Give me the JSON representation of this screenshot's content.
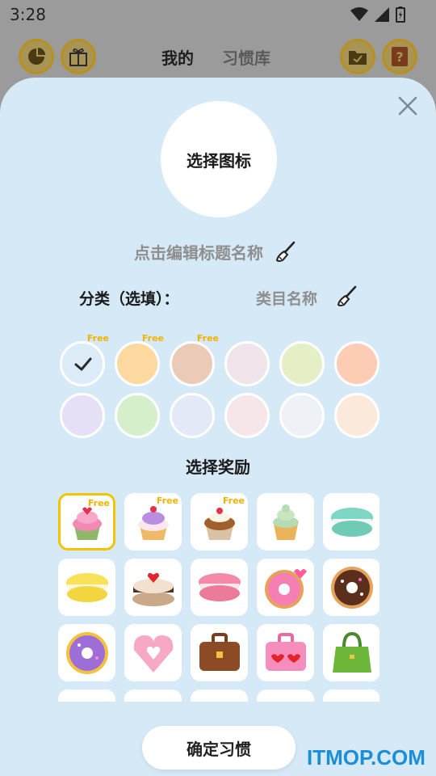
{
  "status": {
    "time": "3:28"
  },
  "topbar": {
    "tab_mine": "我的",
    "tab_library": "习惯库"
  },
  "sheet": {
    "icon_select": "选择图标",
    "title_placeholder": "点击编辑标题名称",
    "category_label": "分类（选填）：",
    "category_placeholder": "类目名称",
    "reward_title": "选择奖励",
    "confirm": "确定习惯",
    "free_badge": "Free"
  },
  "colors": [
    {
      "hex": "#dcebf8",
      "free": true,
      "selected": true
    },
    {
      "hex": "#fdd9a0",
      "free": true,
      "selected": false
    },
    {
      "hex": "#ebcab8",
      "free": true,
      "selected": false
    },
    {
      "hex": "#f0e3ea",
      "free": false,
      "selected": false
    },
    {
      "hex": "#e4efc6",
      "free": false,
      "selected": false
    },
    {
      "hex": "#fccdb4",
      "free": false,
      "selected": false
    },
    {
      "hex": "#e6e0f7",
      "free": false,
      "selected": false
    },
    {
      "hex": "#d6efcb",
      "free": false,
      "selected": false
    },
    {
      "hex": "#e3e9f7",
      "free": false,
      "selected": false
    },
    {
      "hex": "#f6e6ea",
      "free": false,
      "selected": false
    },
    {
      "hex": "#eef1f5",
      "free": false,
      "selected": false
    },
    {
      "hex": "#fbeadb",
      "free": false,
      "selected": false
    }
  ],
  "rewards": [
    {
      "icon": "cupcake-pink-heart-icon",
      "free": true,
      "selected": true
    },
    {
      "icon": "cupcake-purple-icon",
      "free": true
    },
    {
      "icon": "cupcake-cherry-icon",
      "free": true
    },
    {
      "icon": "cupcake-green-icon"
    },
    {
      "icon": "macaron-mint-icon"
    },
    {
      "icon": "macaron-yellow-icon"
    },
    {
      "icon": "cake-heart-icon"
    },
    {
      "icon": "macaron-pink-icon"
    },
    {
      "icon": "donut-pink-heart-icon"
    },
    {
      "icon": "donut-chocolate-icon"
    },
    {
      "icon": "donut-purple-icon"
    },
    {
      "icon": "donut-heart-pink-icon"
    },
    {
      "icon": "briefcase-brown-icon"
    },
    {
      "icon": "bag-pink-hearts-icon"
    },
    {
      "icon": "handbag-green-icon"
    },
    {
      "icon": "item-partial-1-icon"
    },
    {
      "icon": "item-partial-2-icon"
    },
    {
      "icon": "item-partial-3-icon"
    },
    {
      "icon": "item-partial-4-icon"
    },
    {
      "icon": "item-partial-5-icon"
    }
  ],
  "watermark": "ITMOP.COM"
}
